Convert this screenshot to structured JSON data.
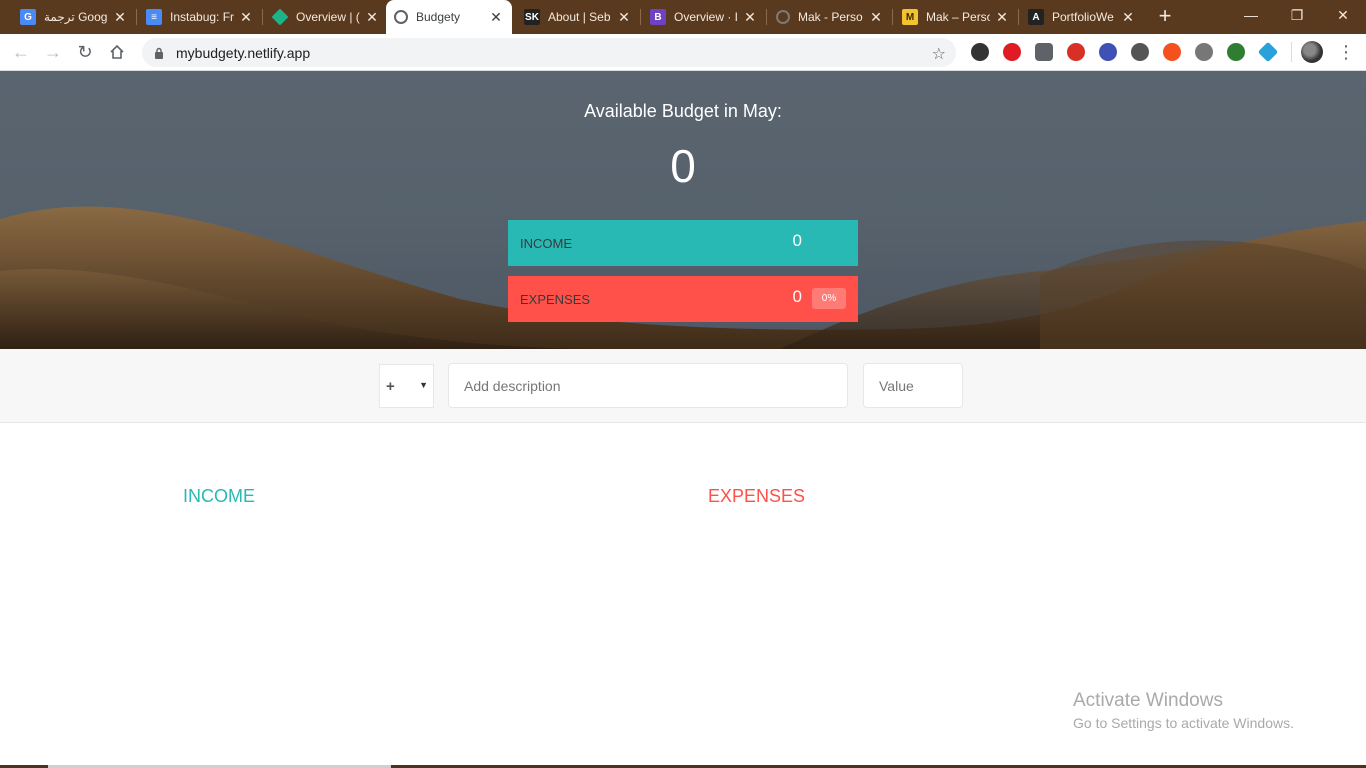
{
  "browser": {
    "tabs": [
      {
        "title": "ترجمة Google",
        "icon": "google-translate-icon",
        "color": "#4a8af4",
        "glyph": "G"
      },
      {
        "title": "Instabug: Fr",
        "icon": "google-docs-icon",
        "color": "#4a8af4",
        "glyph": "≡"
      },
      {
        "title": "Overview | (",
        "icon": "diamond-icon",
        "color": "#1db48c",
        "glyph": ""
      },
      {
        "title": "Budgety",
        "icon": "globe-icon",
        "color": "#5f6368",
        "glyph": "",
        "active": true
      },
      {
        "title": "About | Seb",
        "icon": "sk-logo-icon",
        "color": "#222222",
        "glyph": "SK"
      },
      {
        "title": "Overview · I",
        "icon": "bootstrap-icon",
        "color": "#6f42c1",
        "glyph": "B"
      },
      {
        "title": "Mak - Perso",
        "icon": "globe-icon",
        "color": "#7a7a7a",
        "glyph": ""
      },
      {
        "title": "Mak – Perso",
        "icon": "m-logo-icon",
        "color": "#f2c230",
        "glyph": "M"
      },
      {
        "title": "PortfolioWe",
        "icon": "angular-icon",
        "color": "#222222",
        "glyph": "A"
      }
    ],
    "new_tab": "+",
    "window_controls": {
      "minimize": "—",
      "restore": "❐",
      "close": "✕"
    },
    "url": "mybudgety.netlify.app",
    "extension_colors": [
      "#333333",
      "#e01b24",
      "#5f6368",
      "#d93025",
      "#3f51b5",
      "#555555",
      "#f4511e",
      "#777777",
      "#2e7d32",
      "#2aa1d8"
    ]
  },
  "app": {
    "budget_title": "Available Budget in May:",
    "budget_value": "0",
    "income": {
      "label": "Income",
      "value": "0",
      "color": "#28b9b5"
    },
    "expenses": {
      "label": "Expenses",
      "value": "0",
      "percentage": "0%",
      "color": "#ff5049"
    },
    "add": {
      "type_symbol": "+",
      "description_placeholder": "Add description",
      "value_placeholder": "Value"
    },
    "lists": {
      "income_title": "Income",
      "expenses_title": "Expenses"
    }
  },
  "watermark": {
    "title": "Activate Windows",
    "subtitle": "Go to Settings to activate Windows."
  }
}
